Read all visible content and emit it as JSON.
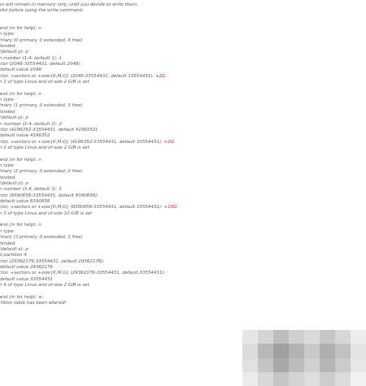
{
  "terminal": {
    "lines": [
      {
        "text": "es will remain in memory only, until you decide to write them."
      },
      {
        "text": "eful before using the write command."
      },
      {
        "text": ""
      },
      {
        "text": ""
      },
      {
        "text": "and (m for help): n"
      },
      {
        "text": "n type:"
      },
      {
        "text": "imary (0 primary, 0 extended, 4 free)"
      },
      {
        "text": "tended"
      },
      {
        "text": "(default p): p"
      },
      {
        "text": "n number (1-4, default 1): 1"
      },
      {
        "text": "ctor (2048-33554431, default 2048):"
      },
      {
        "text": "default value 2048"
      },
      {
        "text": "ctor, +sectors or +size{K,M,G} (2048-33554431, default 33554431): ",
        "red": "+2G"
      },
      {
        "text": "n 1 of type Linux and of size 2 GiB is set"
      },
      {
        "text": ""
      },
      {
        "text": "and (m for help): n"
      },
      {
        "text": "n type:"
      },
      {
        "text": "imary (1 primary, 0 extended, 3 free)"
      },
      {
        "text": "tended"
      },
      {
        "text": "(default p): p"
      },
      {
        "text": "n number (2-4, default 2): 2"
      },
      {
        "text": "ctor (4196352-33554431, default 4196352):"
      },
      {
        "text": "default value 4196352"
      },
      {
        "text": "ctor, +sectors or +size{K,M,G} (4196352-33554431, default 33554431): ",
        "red": "+2G"
      },
      {
        "text": "n 2 of type Linux and of size 2 GiB is set"
      },
      {
        "text": ""
      },
      {
        "text": "and (m for help): n"
      },
      {
        "text": "n type:"
      },
      {
        "text": "imary (2 primary, 0 extended, 2 free)"
      },
      {
        "text": "tended"
      },
      {
        "text": "(default p): p"
      },
      {
        "text": "n number (3,4, default 3): 3"
      },
      {
        "text": "ctor (8390656-33554431, default 8390656):"
      },
      {
        "text": "default value 8390656"
      },
      {
        "text": "ctor, +sectors or +size{K,M,G} (8390656-33554431, default 33554431): ",
        "red": "+10G"
      },
      {
        "text": "n 3 of type Linux and of size 10 GiB is set"
      },
      {
        "text": ""
      },
      {
        "text": "and (m for help): n"
      },
      {
        "text": "n type:"
      },
      {
        "text": "imary (3 primary, 0 extended, 1 free)"
      },
      {
        "text": "tended"
      },
      {
        "text": "(default e): p"
      },
      {
        "text": "d partition 4"
      },
      {
        "text": "ctor (29362176-33554431, default 29362176):"
      },
      {
        "text": "default value 29362176"
      },
      {
        "text": "ctor, +sectors or +size{K,M,G} (29362176-33554431, default 33554431):"
      },
      {
        "text": "default value 33554431"
      },
      {
        "text": "n 4 of type Linux and of size 2 GiB is set"
      },
      {
        "text": ""
      },
      {
        "text": "and (m for help): w"
      },
      {
        "text": "rtition table has been altered!"
      }
    ]
  }
}
